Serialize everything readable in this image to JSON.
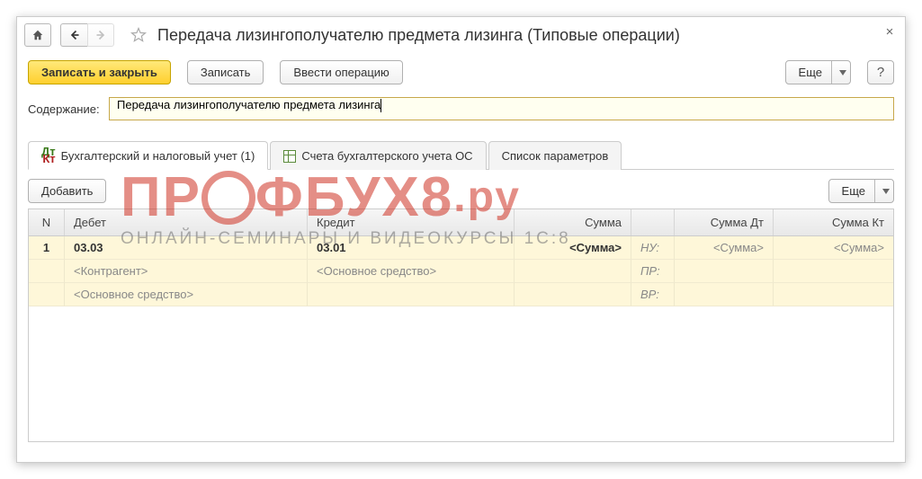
{
  "title": "Передача лизингополучателю предмета лизинга (Типовые операции)",
  "toolbar": {
    "write_close": "Записать и закрыть",
    "write": "Записать",
    "enter_op": "Ввести операцию",
    "more": "Еще"
  },
  "field": {
    "label": "Содержание:",
    "value": "Передача лизингополучателю предмета лизинга"
  },
  "tabs": {
    "t1": "Бухгалтерский и налоговый учет (1)",
    "t2": "Счета бухгалтерского учета ОС",
    "t3": "Список параметров"
  },
  "grid": {
    "add": "Добавить",
    "more": "Еще",
    "head": {
      "n": "N",
      "debet": "Дебет",
      "kredit": "Кредит",
      "summa": "Сумма",
      "summadt": "Сумма Дт",
      "summakt": "Сумма Кт"
    },
    "rows": [
      {
        "n": "1",
        "debet_acc": "03.03",
        "debet_sub1": "<Контрагент>",
        "debet_sub2": "<Основное средство>",
        "kredit_acc": "03.01",
        "kredit_sub1": "<Основное средство>",
        "summa": "<Сумма>",
        "nu": "НУ:",
        "pr": "ПР:",
        "vr": "ВР:",
        "sdt": "<Сумма>",
        "skt": "<Сумма>"
      }
    ]
  },
  "watermark": {
    "big": "ПРОФБУХ8.ру",
    "sub": "ОНЛАЙН-СЕМИНАРЫ И ВИДЕОКУРСЫ 1С:8"
  }
}
